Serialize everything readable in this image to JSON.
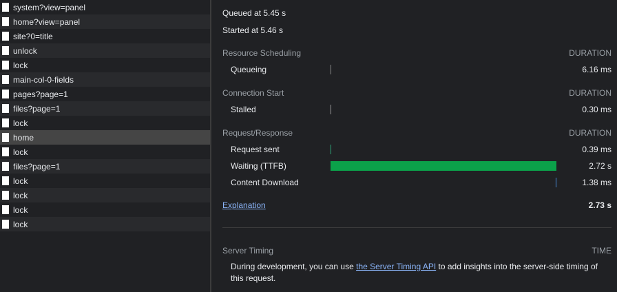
{
  "requests": [
    {
      "name": "system?view=panel"
    },
    {
      "name": "home?view=panel"
    },
    {
      "name": "site?0=title"
    },
    {
      "name": "unlock"
    },
    {
      "name": "lock"
    },
    {
      "name": "main-col-0-fields"
    },
    {
      "name": "pages?page=1"
    },
    {
      "name": "files?page=1"
    },
    {
      "name": "lock"
    },
    {
      "name": "home",
      "selected": true
    },
    {
      "name": "lock"
    },
    {
      "name": "files?page=1"
    },
    {
      "name": "lock"
    },
    {
      "name": "lock"
    },
    {
      "name": "lock"
    },
    {
      "name": "lock"
    }
  ],
  "timing": {
    "queued_at": "Queued at 5.45 s",
    "started_at": "Started at 5.46 s",
    "sections": [
      {
        "title": "Resource Scheduling",
        "duration_label": "DURATION",
        "rows": [
          {
            "label": "Queueing",
            "value": "6.16 ms"
          }
        ]
      },
      {
        "title": "Connection Start",
        "duration_label": "DURATION",
        "rows": [
          {
            "label": "Stalled",
            "value": "0.30 ms"
          }
        ]
      },
      {
        "title": "Request/Response",
        "duration_label": "DURATION",
        "rows": [
          {
            "label": "Request sent",
            "value": "0.39 ms"
          },
          {
            "label": "Waiting (TTFB)",
            "value": "2.72 s"
          },
          {
            "label": "Content Download",
            "value": "1.38 ms"
          }
        ]
      }
    ],
    "explanation": "Explanation",
    "total": "2.73 s",
    "server_timing": {
      "title": "Server Timing",
      "time_label": "TIME",
      "text_before": "During development, you can use ",
      "link": "the Server Timing API",
      "text_after": " to add insights into the server-side timing of this request."
    },
    "colors": {
      "waiting_bar": "#0ba14a",
      "download_tick": "#4a8fdf",
      "queue_tick": "#8a8a8a"
    }
  }
}
